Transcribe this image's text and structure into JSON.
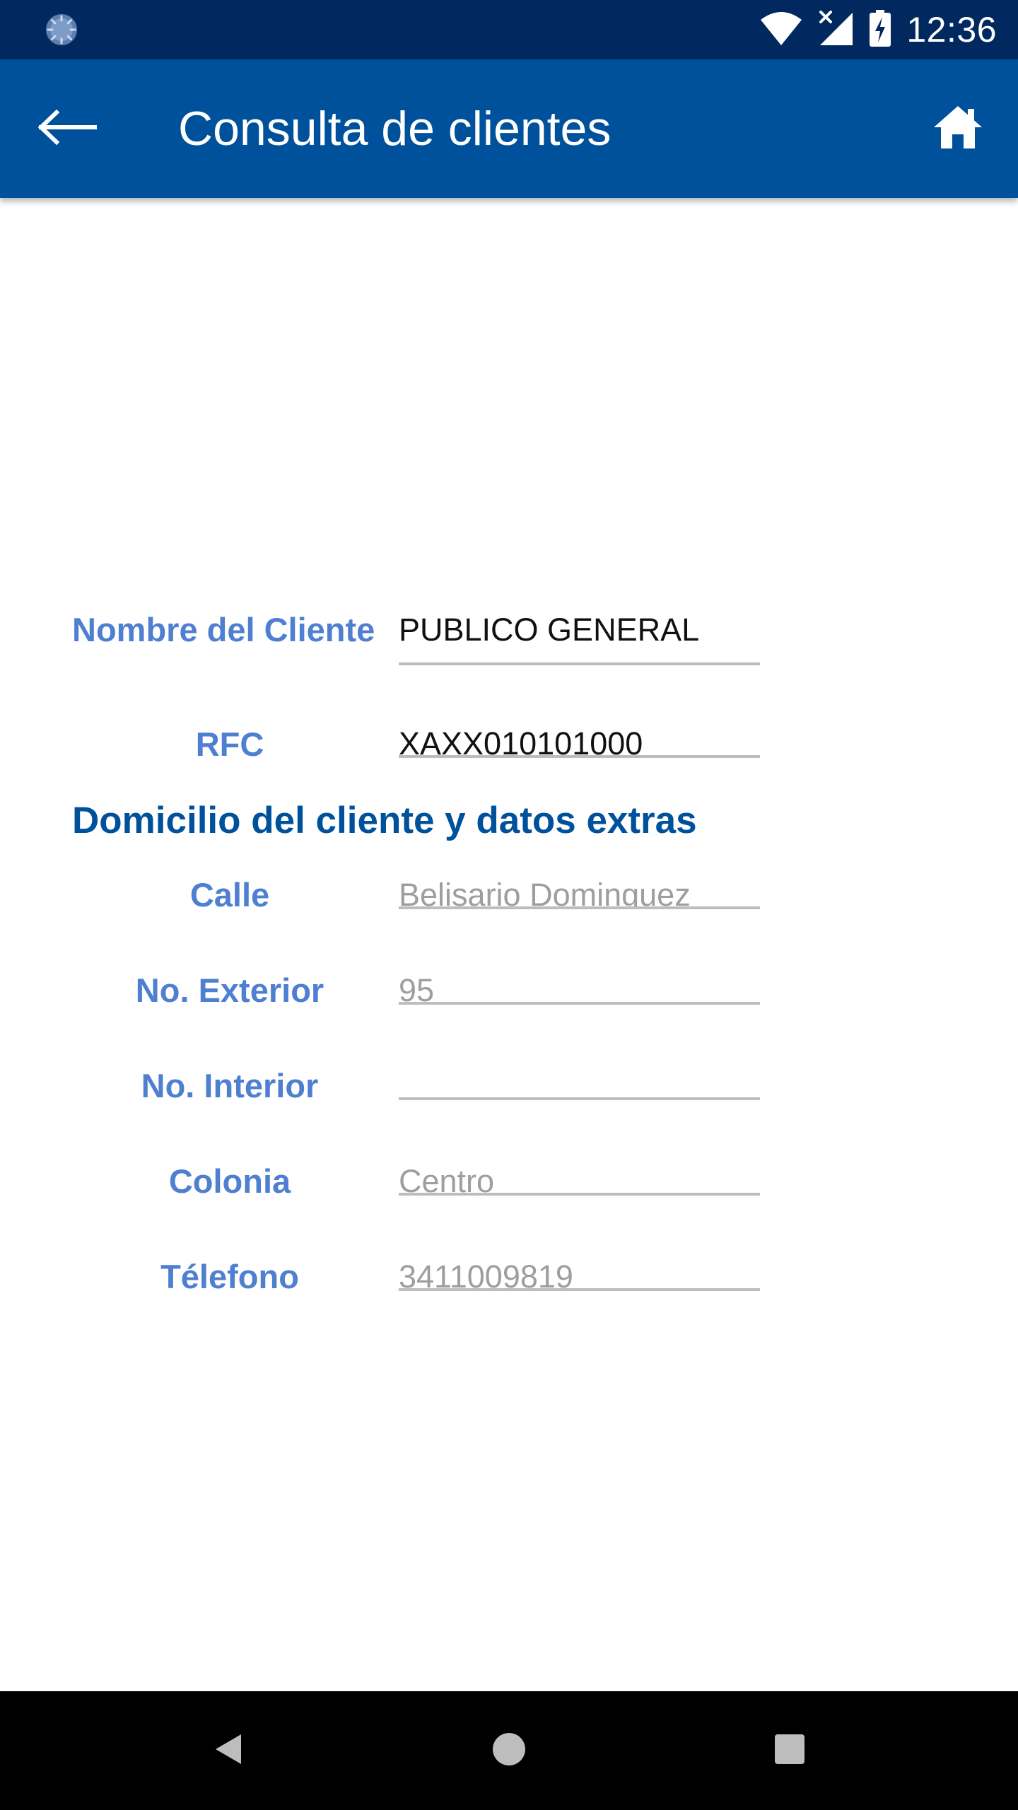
{
  "status_bar": {
    "time": "12:36",
    "icons": [
      "notification-spinner-icon",
      "wifi-icon",
      "no-signal-icon",
      "battery-charging-icon"
    ]
  },
  "app_bar": {
    "title": "Consulta de clientes",
    "back_icon": "arrow-left-icon",
    "home_icon": "home-icon"
  },
  "form": {
    "client_name": {
      "label": "Nombre del Cliente",
      "value": "PUBLICO GENERAL"
    },
    "rfc": {
      "label": "RFC",
      "value": "XAXX010101000"
    },
    "section_heading": "Domicilio del cliente y datos extras",
    "calle": {
      "label": "Calle",
      "placeholder": "Belisario Dominguez"
    },
    "no_exterior": {
      "label": "No. Exterior",
      "placeholder": "95"
    },
    "no_interior": {
      "label": "No. Interior",
      "placeholder": ""
    },
    "colonia": {
      "label": "Colonia",
      "placeholder": "Centro"
    },
    "telefono": {
      "label": "Télefono",
      "placeholder": "3411009819"
    }
  },
  "nav_bar": {
    "icons": [
      "back-triangle-icon",
      "home-circle-icon",
      "recents-square-icon"
    ]
  },
  "colors": {
    "status_bar": "#01295f",
    "app_bar": "#00519b",
    "label": "#4e7fd0",
    "heading": "#00519b",
    "hint_text": "#9e9e9e",
    "underline": "#bdbdbd"
  }
}
